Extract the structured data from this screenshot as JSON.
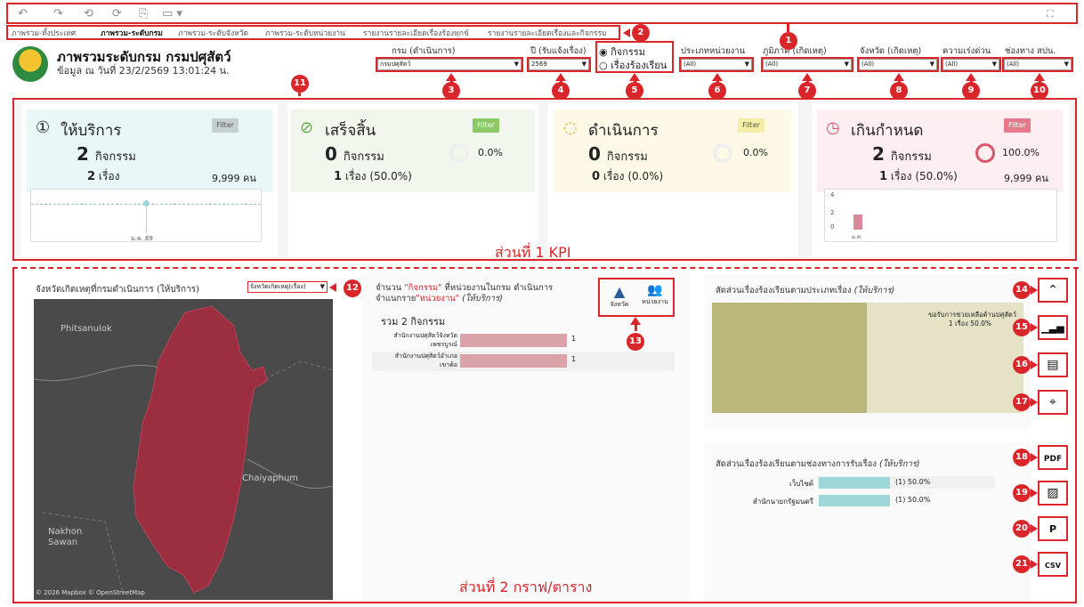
{
  "toolbar": {
    "icons": [
      "undo-icon",
      "redo-icon",
      "revert-icon",
      "refresh-icon",
      "pause-icon",
      "more-icon",
      "fullscreen-icon"
    ]
  },
  "tabs": [
    "ภาพรวม-ทั้งประเทศ",
    "ภาพรวม-ระดับกรม",
    "ภาพรวม-ระดับจังหวัด",
    "ภาพรวม-ระดับหน่วยงาน",
    "รายงานรายละเอียดเรื่องร้องทุกข์",
    "รายงานรายละเอียดเรื่องและกิจกรรม"
  ],
  "header": {
    "title": "ภาพรวมระดับกรม กรมปศุสัตว์",
    "subtitle": "ข้อมูล ณ วันที่ 23/2/2569 13:01:24 น."
  },
  "filters": {
    "dept": {
      "label": "กรม (ดำเนินการ)",
      "value": "กรมปศุสัตว์"
    },
    "year": {
      "label": "ปี (รับแจ้งเรื่อง)",
      "value": "2569"
    },
    "radio": {
      "opt1": "กิจกรรม",
      "opt2": "เรื่องร้องเรียน"
    },
    "unit_type": {
      "label": "ประเภทหน่วยงาน",
      "value": "(All)"
    },
    "region": {
      "label": "ภูมิภาค (เกิดเหตุ)",
      "value": "(All)"
    },
    "province": {
      "label": "จังหวัด (เกิดเหตุ)",
      "value": "(All)"
    },
    "urgency": {
      "label": "ความเร่งด่วน",
      "value": "(All)"
    },
    "channel": {
      "label": "ช่องทาง สปน.",
      "value": "(All)"
    }
  },
  "badges": [
    "1",
    "2",
    "3",
    "4",
    "5",
    "6",
    "7",
    "8",
    "9",
    "10",
    "11",
    "12",
    "13",
    "14",
    "15",
    "16",
    "17",
    "18",
    "19",
    "20",
    "21"
  ],
  "kpi": {
    "service": {
      "title": "ให้บริการ",
      "filter": "Filter",
      "count": "2",
      "unit": "กิจกรรม",
      "stories": "2",
      "stories_unit": "เรื่อง",
      "people": "9,999 คน",
      "axis_label": "ม.ค. 69"
    },
    "done": {
      "title": "เสร็จสิ้น",
      "filter": "Filter",
      "count": "0",
      "unit": "กิจกรรม",
      "pct": "0.0%",
      "stories": "1",
      "stories_unit": "เรื่อง",
      "stories_pct": "(50.0%)"
    },
    "progress": {
      "title": "ดำเนินการ",
      "filter": "Filter",
      "count": "0",
      "unit": "กิจกรรม",
      "pct": "0.0%",
      "stories": "0",
      "stories_unit": "เรื่อง",
      "stories_pct": "(0.0%)"
    },
    "overdue": {
      "title": "เกินกำหนด",
      "filter": "Filter",
      "count": "2",
      "unit": "กิจกรรม",
      "pct": "100.0%",
      "stories": "1",
      "stories_unit": "เรื่อง",
      "stories_pct": "(50.0%)",
      "people": "9,999 คน",
      "ticks": [
        "4",
        "2",
        "0"
      ],
      "x_label": "ม.ค."
    },
    "section_label": "ส่วนที่ 1 KPI"
  },
  "map": {
    "title": "จังหวัดเกิดเหตุที่กรมดำเนินการ (ให้บริการ)",
    "select": "จังหวัดเกิดเหตุ(เรื่อง)",
    "labels": [
      "Phitsanulok",
      "Chaiyaphum",
      "Nakhon",
      "Sawan"
    ],
    "credit": "© 2026 Mapbox © OpenStreetMap"
  },
  "units_chart": {
    "title1": "จำนวน ",
    "title_hl1": "\"กิจกรรม\"",
    "title2": " ที่หน่วยงานในกรม ดำเนินการ",
    "title3": "จำแนกราย",
    "title_hl2": "\"หน่วยงาน\"",
    "title4": " (ให้บริการ)",
    "total": "รวม  2 กิจกรรม",
    "btn_province": "จังหวัด",
    "btn_unit": "หน่วยงาน"
  },
  "chart_data": [
    {
      "type": "bar",
      "title": "จำนวน \"กิจกรรม\" ที่หน่วยงานในกรม ดำเนินการ จำแนกราย\"หน่วยงาน\" (ให้บริการ)",
      "categories": [
        "สำนักงานปศุสัตว์จังหวัดเพชรบูรณ์",
        "สำนักงานปศุสัตว์อำเภอเขาค้อ"
      ],
      "values": [
        1,
        1
      ]
    },
    {
      "type": "heatmap",
      "title": "สัดส่วนเรื่องร้องเรียนตามประเภทเรื่อง (ให้บริการ)",
      "categories": [
        "ขอรับการช่วยเหลือด้านปศุสัตว์"
      ],
      "values": [
        1
      ],
      "labels": [
        "1 เรื่อง 50.0%"
      ]
    },
    {
      "type": "bar",
      "title": "สัดส่วนเรื่องร้องเรียนตามช่องทางการรับเรื่อง (ให้บริการ)",
      "categories": [
        "เว็บไซต์",
        "สำนักนายกรัฐมนตรี"
      ],
      "values": [
        1,
        1
      ],
      "labels": [
        "(1) 50.0%",
        "(1) 50.0%"
      ]
    }
  ],
  "units_rows": [
    {
      "label1": "สำนักงานปศุสัตว์จังหวัด",
      "label2": "เพชรบูรณ์",
      "value": "1"
    },
    {
      "label1": "สำนักงานปศุสัตว์อำเภอ",
      "label2": "เขาค้อ",
      "value": "1"
    }
  ],
  "type_chart": {
    "title": "สัดส่วนเรื่องร้องเรียนตามประเภทเรื่อง",
    "title_em": "(ให้บริการ)",
    "cell_label": "ขอรับการช่วยเหลือด้านปศุสัตว์",
    "cell_value": "1 เรื่อง 50.0%"
  },
  "channel_chart": {
    "title": "สัดส่วนเรื่องร้องเรียนตามช่องทางการรับเรื่อง",
    "title_em": "(ให้บริการ)",
    "rows": [
      {
        "label": "เว็บไซต์",
        "value": "(1) 50.0%"
      },
      {
        "label": "สำนักนายกรัฐมนตรี",
        "value": "(1) 50.0%"
      }
    ]
  },
  "section2_label": "ส่วนที่ 2 กราฟ/ตาราง",
  "side_buttons": [
    "collapse-icon",
    "bar-chart-icon",
    "province-list-icon",
    "location-list-icon",
    "pdf-icon",
    "image-icon",
    "powerpoint-icon",
    "csv-icon"
  ]
}
